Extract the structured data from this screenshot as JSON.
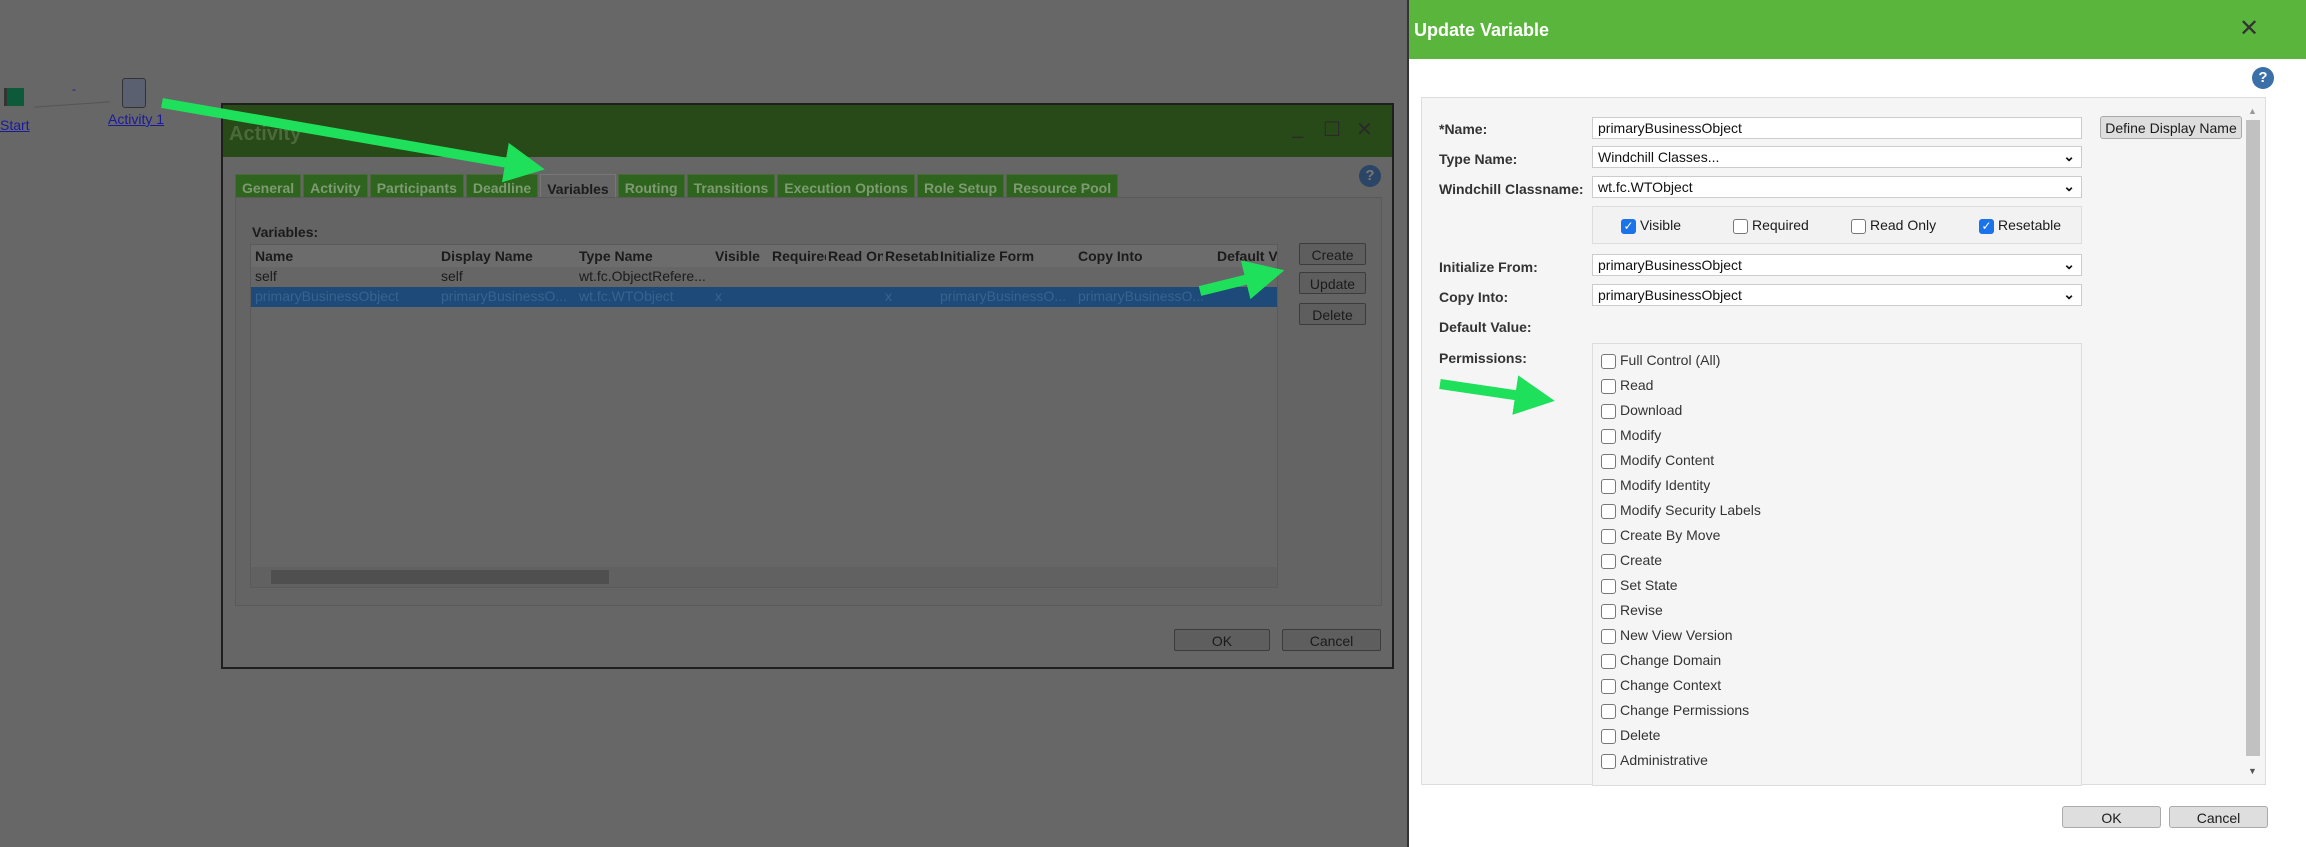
{
  "workflow": {
    "start_label": "Start",
    "activity_label": "Activity 1",
    "link_label": "-"
  },
  "activity_dialog": {
    "title": "Activity",
    "tabs": [
      "General",
      "Activity",
      "Participants",
      "Deadline",
      "Variables",
      "Routing",
      "Transitions",
      "Execution Options",
      "Role Setup",
      "Resource Pool"
    ],
    "active_tab": "Variables",
    "variables_label": "Variables:",
    "columns": [
      "Name",
      "Display Name",
      "Type Name",
      "Visible",
      "Required",
      "Read Only",
      "Resetable",
      "Initialize Form",
      "Copy Into",
      "Default Va"
    ],
    "rows": [
      [
        "self",
        "self",
        "wt.fc.ObjectRefere...",
        "",
        "",
        "",
        "",
        "",
        "",
        ""
      ],
      [
        "primaryBusinessObject",
        "primaryBusinessO...",
        "wt.fc.WTObject",
        "x",
        "",
        "",
        "x",
        "primaryBusinessO...",
        "primaryBusinessO...",
        ""
      ]
    ],
    "selected_row": 1,
    "buttons": {
      "create": "Create",
      "update": "Update",
      "delete": "Delete",
      "ok": "OK",
      "cancel": "Cancel"
    }
  },
  "update_dialog": {
    "title": "Update Variable",
    "name_label": "*Name:",
    "name_value": "primaryBusinessObject",
    "define_display_name": "Define Display Name",
    "type_label": "Type Name:",
    "type_value": "Windchill Classes...",
    "classname_label": "Windchill Classname:",
    "classname_value": "wt.fc.WTObject",
    "flags": [
      {
        "label": "Visible",
        "checked": true
      },
      {
        "label": "Required",
        "checked": false
      },
      {
        "label": "Read Only",
        "checked": false
      },
      {
        "label": "Resetable",
        "checked": true
      }
    ],
    "init_label": "Initialize From:",
    "init_value": "primaryBusinessObject",
    "copy_label": "Copy Into:",
    "copy_value": "primaryBusinessObject",
    "default_label": "Default Value:",
    "permissions_label": "Permissions:",
    "permissions": [
      "Full Control (All)",
      "Read",
      "Download",
      "Modify",
      "Modify Content",
      "Modify Identity",
      "Modify Security Labels",
      "Create By Move",
      "Create",
      "Set State",
      "Revise",
      "New View Version",
      "Change Domain",
      "Change Context",
      "Change Permissions",
      "Delete",
      "Administrative"
    ],
    "ok": "OK",
    "cancel": "Cancel"
  },
  "colors": {
    "arrow": "#1ee05a",
    "header_green": "#5ab53c"
  }
}
